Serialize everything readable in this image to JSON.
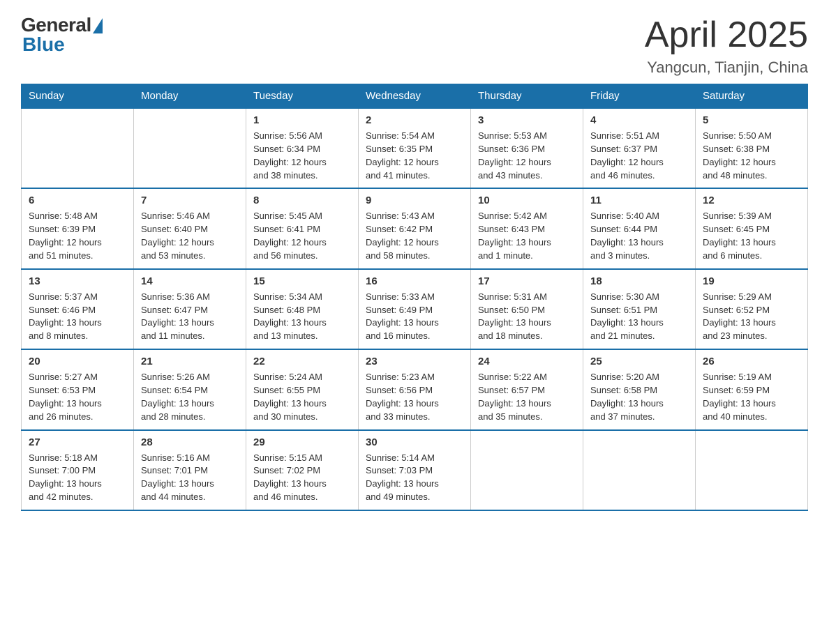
{
  "logo": {
    "general_text": "General",
    "blue_text": "Blue"
  },
  "header": {
    "title": "April 2025",
    "subtitle": "Yangcun, Tianjin, China"
  },
  "days_of_week": [
    "Sunday",
    "Monday",
    "Tuesday",
    "Wednesday",
    "Thursday",
    "Friday",
    "Saturday"
  ],
  "weeks": [
    {
      "days": [
        {
          "num": "",
          "info": ""
        },
        {
          "num": "",
          "info": ""
        },
        {
          "num": "1",
          "info": "Sunrise: 5:56 AM\nSunset: 6:34 PM\nDaylight: 12 hours\nand 38 minutes."
        },
        {
          "num": "2",
          "info": "Sunrise: 5:54 AM\nSunset: 6:35 PM\nDaylight: 12 hours\nand 41 minutes."
        },
        {
          "num": "3",
          "info": "Sunrise: 5:53 AM\nSunset: 6:36 PM\nDaylight: 12 hours\nand 43 minutes."
        },
        {
          "num": "4",
          "info": "Sunrise: 5:51 AM\nSunset: 6:37 PM\nDaylight: 12 hours\nand 46 minutes."
        },
        {
          "num": "5",
          "info": "Sunrise: 5:50 AM\nSunset: 6:38 PM\nDaylight: 12 hours\nand 48 minutes."
        }
      ]
    },
    {
      "days": [
        {
          "num": "6",
          "info": "Sunrise: 5:48 AM\nSunset: 6:39 PM\nDaylight: 12 hours\nand 51 minutes."
        },
        {
          "num": "7",
          "info": "Sunrise: 5:46 AM\nSunset: 6:40 PM\nDaylight: 12 hours\nand 53 minutes."
        },
        {
          "num": "8",
          "info": "Sunrise: 5:45 AM\nSunset: 6:41 PM\nDaylight: 12 hours\nand 56 minutes."
        },
        {
          "num": "9",
          "info": "Sunrise: 5:43 AM\nSunset: 6:42 PM\nDaylight: 12 hours\nand 58 minutes."
        },
        {
          "num": "10",
          "info": "Sunrise: 5:42 AM\nSunset: 6:43 PM\nDaylight: 13 hours\nand 1 minute."
        },
        {
          "num": "11",
          "info": "Sunrise: 5:40 AM\nSunset: 6:44 PM\nDaylight: 13 hours\nand 3 minutes."
        },
        {
          "num": "12",
          "info": "Sunrise: 5:39 AM\nSunset: 6:45 PM\nDaylight: 13 hours\nand 6 minutes."
        }
      ]
    },
    {
      "days": [
        {
          "num": "13",
          "info": "Sunrise: 5:37 AM\nSunset: 6:46 PM\nDaylight: 13 hours\nand 8 minutes."
        },
        {
          "num": "14",
          "info": "Sunrise: 5:36 AM\nSunset: 6:47 PM\nDaylight: 13 hours\nand 11 minutes."
        },
        {
          "num": "15",
          "info": "Sunrise: 5:34 AM\nSunset: 6:48 PM\nDaylight: 13 hours\nand 13 minutes."
        },
        {
          "num": "16",
          "info": "Sunrise: 5:33 AM\nSunset: 6:49 PM\nDaylight: 13 hours\nand 16 minutes."
        },
        {
          "num": "17",
          "info": "Sunrise: 5:31 AM\nSunset: 6:50 PM\nDaylight: 13 hours\nand 18 minutes."
        },
        {
          "num": "18",
          "info": "Sunrise: 5:30 AM\nSunset: 6:51 PM\nDaylight: 13 hours\nand 21 minutes."
        },
        {
          "num": "19",
          "info": "Sunrise: 5:29 AM\nSunset: 6:52 PM\nDaylight: 13 hours\nand 23 minutes."
        }
      ]
    },
    {
      "days": [
        {
          "num": "20",
          "info": "Sunrise: 5:27 AM\nSunset: 6:53 PM\nDaylight: 13 hours\nand 26 minutes."
        },
        {
          "num": "21",
          "info": "Sunrise: 5:26 AM\nSunset: 6:54 PM\nDaylight: 13 hours\nand 28 minutes."
        },
        {
          "num": "22",
          "info": "Sunrise: 5:24 AM\nSunset: 6:55 PM\nDaylight: 13 hours\nand 30 minutes."
        },
        {
          "num": "23",
          "info": "Sunrise: 5:23 AM\nSunset: 6:56 PM\nDaylight: 13 hours\nand 33 minutes."
        },
        {
          "num": "24",
          "info": "Sunrise: 5:22 AM\nSunset: 6:57 PM\nDaylight: 13 hours\nand 35 minutes."
        },
        {
          "num": "25",
          "info": "Sunrise: 5:20 AM\nSunset: 6:58 PM\nDaylight: 13 hours\nand 37 minutes."
        },
        {
          "num": "26",
          "info": "Sunrise: 5:19 AM\nSunset: 6:59 PM\nDaylight: 13 hours\nand 40 minutes."
        }
      ]
    },
    {
      "days": [
        {
          "num": "27",
          "info": "Sunrise: 5:18 AM\nSunset: 7:00 PM\nDaylight: 13 hours\nand 42 minutes."
        },
        {
          "num": "28",
          "info": "Sunrise: 5:16 AM\nSunset: 7:01 PM\nDaylight: 13 hours\nand 44 minutes."
        },
        {
          "num": "29",
          "info": "Sunrise: 5:15 AM\nSunset: 7:02 PM\nDaylight: 13 hours\nand 46 minutes."
        },
        {
          "num": "30",
          "info": "Sunrise: 5:14 AM\nSunset: 7:03 PM\nDaylight: 13 hours\nand 49 minutes."
        },
        {
          "num": "",
          "info": ""
        },
        {
          "num": "",
          "info": ""
        },
        {
          "num": "",
          "info": ""
        }
      ]
    }
  ]
}
